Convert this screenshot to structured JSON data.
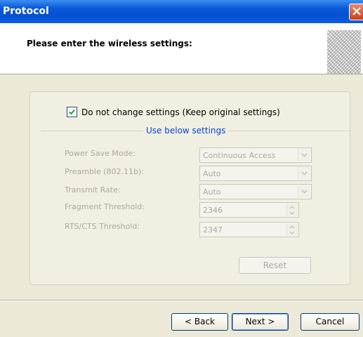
{
  "window": {
    "title": "Protocol"
  },
  "header": {
    "title": "Please enter the wireless settings:"
  },
  "settings": {
    "keep_original_label": "Do not change settings (Keep original settings)",
    "keep_original_checked": true,
    "group_label": "Use below settings",
    "power_save": {
      "label": "Power Save Mode:",
      "value": "Continuous Access"
    },
    "preamble": {
      "label": "Preamble (802.11b):",
      "value": "Auto"
    },
    "transmit_rate": {
      "label": "Transmit Rate:",
      "value": "Auto"
    },
    "fragment": {
      "label": "Fragment Threshold:",
      "value": "2346"
    },
    "rts_cts": {
      "label": "RTS/CTS Threshold:",
      "value": "2347"
    },
    "reset_label": "Reset"
  },
  "footer": {
    "back_label": "< Back",
    "next_label": "Next >",
    "cancel_label": "Cancel"
  },
  "colors": {
    "titlebar": "#0a5ad8",
    "group_label": "#0046d5",
    "disabled_text": "#aca899"
  }
}
